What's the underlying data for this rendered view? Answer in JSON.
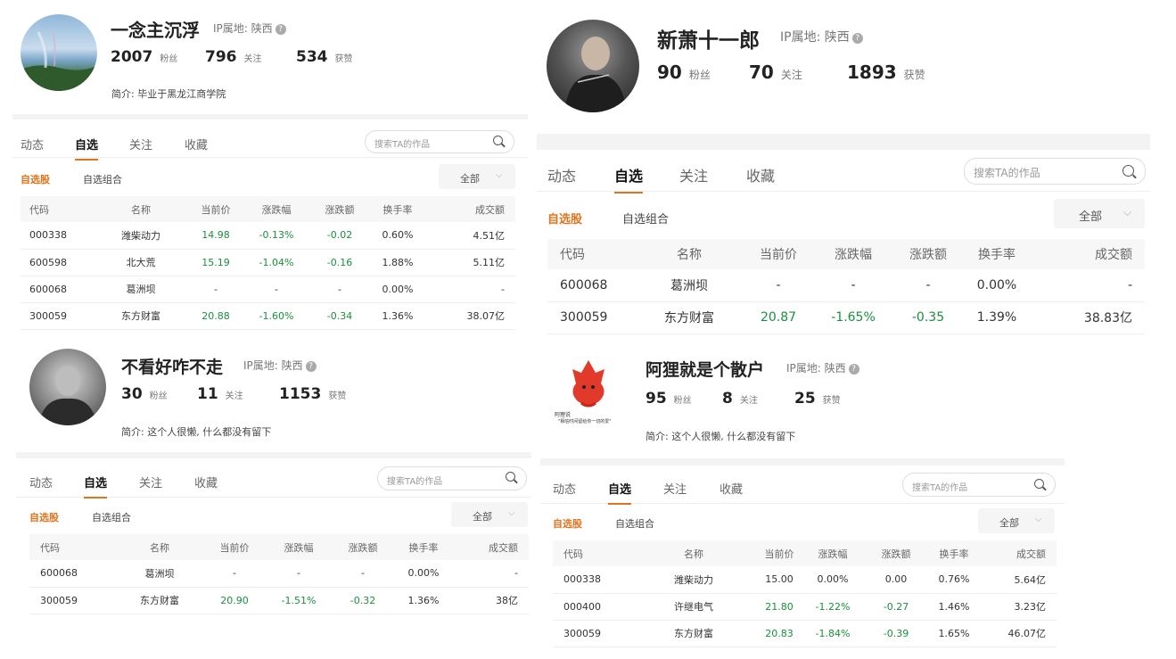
{
  "common": {
    "ip_label": "IP属地: 陕西",
    "help_icon": "question-circle-icon",
    "fans_label": "粉丝",
    "follow_label": "关注",
    "likes_label": "获赞",
    "tabs": [
      "动态",
      "自选",
      "关注",
      "收藏"
    ],
    "active_tab": "自选",
    "search_placeholder": "搜索TA的作品",
    "subtabs": [
      "自选股",
      "自选组合"
    ],
    "dropdown": "全部",
    "columns": [
      "代码",
      "名称",
      "当前价",
      "涨跌幅",
      "涨跌额",
      "换手率",
      "成交额"
    ],
    "accent_color": "#e0741c",
    "up_down_color": "#1a8f3c"
  },
  "panels": [
    {
      "name": "一念主沉浮",
      "fans": "2007",
      "follow": "796",
      "likes": "534",
      "bio": "简介: 毕业于黑龙江商学院",
      "rows": [
        [
          "000338",
          "潍柴动力",
          "14.98",
          "-0.13%",
          "-0.02",
          "0.60%",
          "4.51亿"
        ],
        [
          "600598",
          "北大荒",
          "15.19",
          "-1.04%",
          "-0.16",
          "1.88%",
          "5.11亿"
        ],
        [
          "600068",
          "葛洲坝",
          "-",
          "-",
          "-",
          "0.00%",
          "-"
        ],
        [
          "300059",
          "东方财富",
          "20.88",
          "-1.60%",
          "-0.34",
          "1.36%",
          "38.07亿"
        ]
      ]
    },
    {
      "name": "新萧十一郎",
      "fans": "90",
      "follow": "70",
      "likes": "1893",
      "bio": "",
      "rows": [
        [
          "600068",
          "葛洲坝",
          "-",
          "-",
          "-",
          "0.00%",
          "-"
        ],
        [
          "300059",
          "东方财富",
          "20.87",
          "-1.65%",
          "-0.35",
          "1.39%",
          "38.83亿"
        ]
      ]
    },
    {
      "name": "不看好咋不走",
      "fans": "30",
      "follow": "11",
      "likes": "1153",
      "bio": "简介: 这个人很懒, 什么都没有留下",
      "rows": [
        [
          "600068",
          "葛洲坝",
          "-",
          "-",
          "-",
          "0.00%",
          "-"
        ],
        [
          "300059",
          "东方财富",
          "20.90",
          "-1.51%",
          "-0.32",
          "1.36%",
          "38亿"
        ]
      ]
    },
    {
      "name": "阿狸就是个散户",
      "fans": "95",
      "follow": "8",
      "likes": "25",
      "bio": "简介: 这个人很懒, 什么都没有留下",
      "avatar_caption_1": "阿狸说",
      "avatar_caption_2": "\"相信时间留给你一切的爱\"",
      "rows": [
        [
          "000338",
          "潍柴动力",
          "15.00",
          "0.00%",
          "0.00",
          "0.76%",
          "5.64亿"
        ],
        [
          "000400",
          "许继电气",
          "21.80",
          "-1.22%",
          "-0.27",
          "1.46%",
          "3.23亿"
        ],
        [
          "300059",
          "东方财富",
          "20.83",
          "-1.84%",
          "-0.39",
          "1.65%",
          "46.07亿"
        ]
      ]
    }
  ]
}
